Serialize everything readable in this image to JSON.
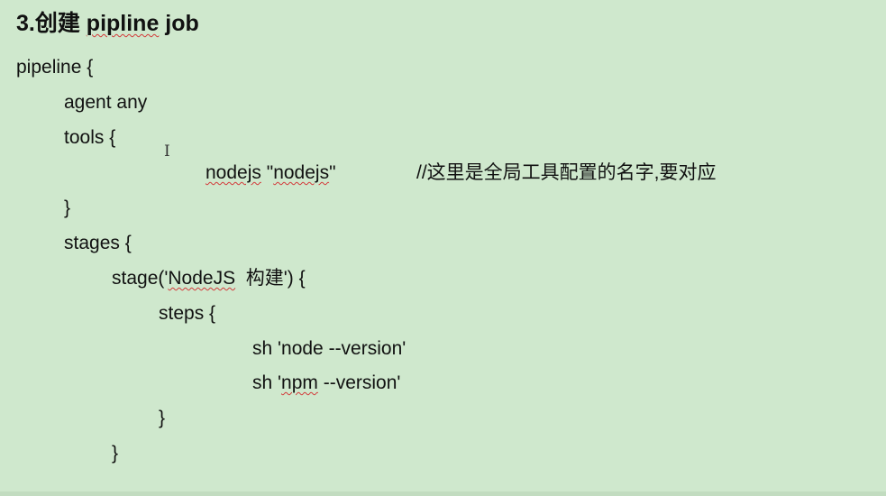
{
  "heading": {
    "prefix": "3.创建 ",
    "word": "pipline",
    "suffix": " job"
  },
  "code": {
    "l1": "pipeline {",
    "l2": "agent any",
    "l3": "tools {",
    "l4_a": "nodejs",
    "l4_b": " \"",
    "l4_c": "nodejs",
    "l4_d": "\"",
    "l4_comment": "//这里是全局工具配置的名字,要对应",
    "l5": "}",
    "l6": "stages {",
    "l7_a": "stage('",
    "l7_b": "NodeJS",
    "l7_c": "  构建') {",
    "l8": "steps {",
    "l9": "sh 'node --version'",
    "l10_a": "sh '",
    "l10_b": "npm",
    "l10_c": " --version'",
    "l11": "}",
    "l12": "}"
  }
}
